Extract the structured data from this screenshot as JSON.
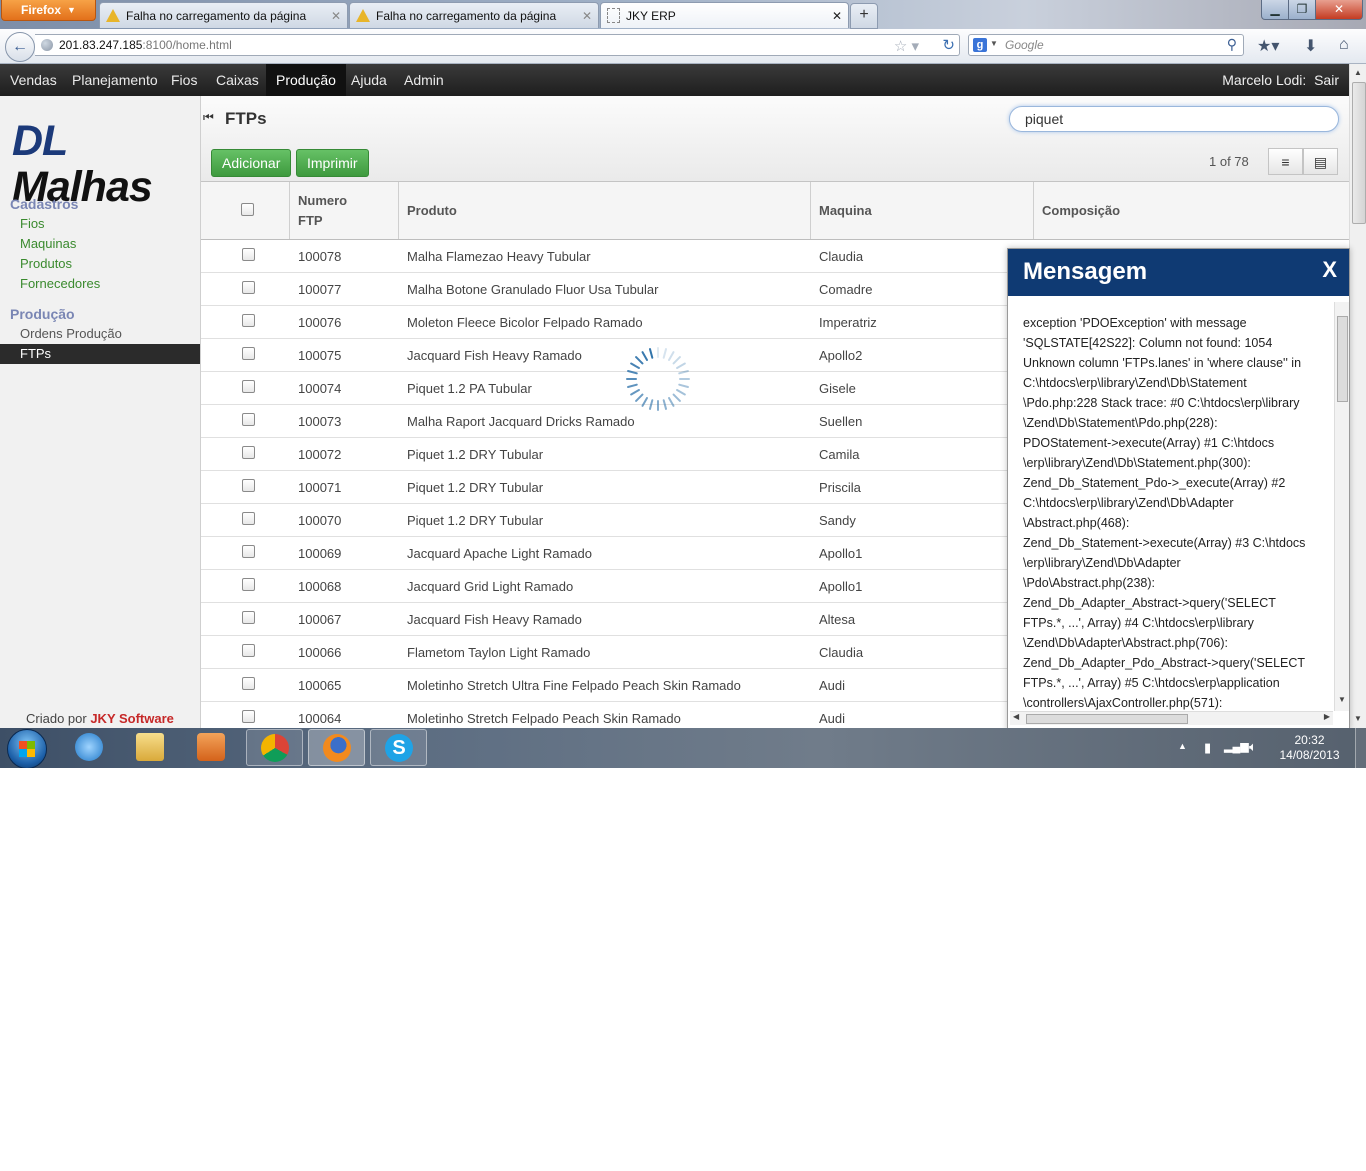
{
  "browser": {
    "menu_button": "Firefox",
    "tabs": [
      {
        "label": "Falha no carregamento da página"
      },
      {
        "label": "Falha no carregamento da página"
      },
      {
        "label": "JKY ERP"
      }
    ],
    "url_host": "201.83.247.185",
    "url_rest": ":8100/home.html",
    "search_placeholder": "Google"
  },
  "app": {
    "menu": [
      "Vendas",
      "Planejamento",
      "Fios",
      "Caixas",
      "Produção",
      "Ajuda",
      "Admin"
    ],
    "active_menu": "Produção",
    "user": "Marcelo Lodi:",
    "logout": "Sair",
    "logo_dl": "DL",
    "logo_name": "Malhas",
    "sidebar": {
      "section1": "Cadastros",
      "section1_items": [
        "Fios",
        "Maquinas",
        "Produtos",
        "Fornecedores"
      ],
      "section2": "Produção",
      "section2_items": [
        "Ordens Produção",
        "FTPs"
      ]
    },
    "credit_prefix": "Criado por",
    "credit_brand": "JKY Software",
    "page_title": "FTPs",
    "filter_value": "piquet",
    "add_label": "Adicionar",
    "print_label": "Imprimir",
    "pager": "1 of 78",
    "columns": {
      "number_line1": "Numero",
      "number_line2": "FTP",
      "product": "Produto",
      "machine": "Maquina",
      "composition": "Composição"
    },
    "rows": [
      {
        "number": "100078",
        "product": "Malha Flamezao Heavy Tubular",
        "machine": "Claudia"
      },
      {
        "number": "100077",
        "product": "Malha Botone Granulado Fluor Usa Tubular",
        "machine": "Comadre"
      },
      {
        "number": "100076",
        "product": "Moleton Fleece Bicolor Felpado Ramado",
        "machine": "Imperatriz"
      },
      {
        "number": "100075",
        "product": "Jacquard Fish Heavy Ramado",
        "machine": "Apollo2"
      },
      {
        "number": "100074",
        "product": "Piquet 1.2 PA Tubular",
        "machine": "Gisele"
      },
      {
        "number": "100073",
        "product": "Malha Raport Jacquard Dricks Ramado",
        "machine": "Suellen"
      },
      {
        "number": "100072",
        "product": "Piquet 1.2 DRY Tubular",
        "machine": "Camila"
      },
      {
        "number": "100071",
        "product": "Piquet 1.2 DRY Tubular",
        "machine": "Priscila"
      },
      {
        "number": "100070",
        "product": "Piquet 1.2 DRY Tubular",
        "machine": "Sandy"
      },
      {
        "number": "100069",
        "product": "Jacquard Apache Light Ramado",
        "machine": "Apollo1"
      },
      {
        "number": "100068",
        "product": "Jacquard Grid Light Ramado",
        "machine": "Apollo1"
      },
      {
        "number": "100067",
        "product": "Jacquard Fish Heavy Ramado",
        "machine": "Altesa"
      },
      {
        "number": "100066",
        "product": "Flametom Taylon Light Ramado",
        "machine": "Claudia"
      },
      {
        "number": "100065",
        "product": "Moletinho Stretch Ultra Fine Felpado Peach Skin Ramado",
        "machine": "Audi"
      },
      {
        "number": "100064",
        "product": "Moletinho Stretch Felpado Peach Skin Ramado",
        "machine": "Audi"
      }
    ],
    "message": {
      "title": "Mensagem",
      "close": "X",
      "lines": [
        "exception 'PDOException' with message",
        "'SQLSTATE[42S22]: Column not found: 1054",
        "Unknown column 'FTPs.lanes' in 'where clause'' in",
        "C:\\htdocs\\erp\\library\\Zend\\Db\\Statement",
        "\\Pdo.php:228 Stack trace: #0 C:\\htdocs\\erp\\library",
        "\\Zend\\Db\\Statement\\Pdo.php(228):",
        "PDOStatement->execute(Array) #1 C:\\htdocs",
        "\\erp\\library\\Zend\\Db\\Statement.php(300):",
        "Zend_Db_Statement_Pdo->_execute(Array) #2",
        "C:\\htdocs\\erp\\library\\Zend\\Db\\Adapter",
        "\\Abstract.php(468):",
        "Zend_Db_Statement->execute(Array) #3 C:\\htdocs",
        "\\erp\\library\\Zend\\Db\\Adapter",
        "\\Pdo\\Abstract.php(238):",
        "Zend_Db_Adapter_Abstract->query('SELECT",
        "FTPs.*, ...', Array) #4 C:\\htdocs\\erp\\library",
        "\\Zend\\Db\\Adapter\\Abstract.php(706):",
        "Zend_Db_Adapter_Pdo_Abstract->query('SELECT",
        "FTPs.*, ...', Array) #5 C:\\htdocs\\erp\\application",
        "\\controllers\\AjaxController.php(571):"
      ]
    }
  },
  "taskbar": {
    "time": "20:32",
    "date": "14/08/2013"
  },
  "colors": {
    "menu_bg": "#1e1e1e",
    "dialog_title_bg": "#0f3a73",
    "button_green": "#4cae4c",
    "link_green": "#3a8a2e",
    "section_purple": "#7a86b4"
  }
}
